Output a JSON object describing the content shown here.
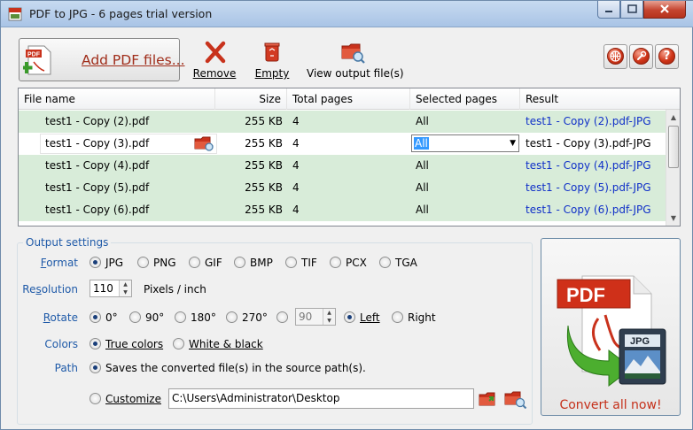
{
  "window": {
    "title": "PDF to JPG - 6 pages trial version"
  },
  "toolbar": {
    "add_pdf_label": "Add PDF files...",
    "remove_label": "Remove",
    "empty_label": "Empty",
    "view_output_label": "View output file(s)"
  },
  "table": {
    "headers": {
      "file_name": "File name",
      "size": "Size",
      "total_pages": "Total pages",
      "selected_pages": "Selected pages",
      "result": "Result"
    },
    "rows": [
      {
        "name": "test1 - Copy (2).pdf",
        "size": "255 KB",
        "pages": "4",
        "selected": "All",
        "result": "test1 - Copy (2).pdf-JPG"
      },
      {
        "name": "test1 - Copy (3).pdf",
        "size": "255 KB",
        "pages": "4",
        "selected": "All",
        "result": "test1 - Copy (3).pdf-JPG"
      },
      {
        "name": "test1 - Copy (4).pdf",
        "size": "255 KB",
        "pages": "4",
        "selected": "All",
        "result": "test1 - Copy (4).pdf-JPG"
      },
      {
        "name": "test1 - Copy (5).pdf",
        "size": "255 KB",
        "pages": "4",
        "selected": "All",
        "result": "test1 - Copy (5).pdf-JPG"
      },
      {
        "name": "test1 - Copy (6).pdf",
        "size": "255 KB",
        "pages": "4",
        "selected": "All",
        "result": "test1 - Copy (6).pdf-JPG"
      }
    ]
  },
  "settings": {
    "legend": "Output settings",
    "format_label": "Format",
    "formats": [
      "JPG",
      "PNG",
      "GIF",
      "BMP",
      "TIF",
      "PCX",
      "TGA"
    ],
    "format_selected": "JPG",
    "resolution_label": "Resolution",
    "resolution_value": "110",
    "resolution_unit": "Pixels / inch",
    "rotate_label": "Rotate",
    "rotations": [
      "0°",
      "90°",
      "180°",
      "270°"
    ],
    "rotate_selected": "0°",
    "custom_angle": "90",
    "direction_left": "Left",
    "direction_right": "Right",
    "direction_selected": "Left",
    "colors_label": "Colors",
    "color_true": "True colors",
    "color_bw": "White & black",
    "colors_selected": "True colors",
    "path_label": "Path",
    "path_source": "Saves the converted file(s) in the source path(s).",
    "path_customize": "Customize",
    "path_value": "C:\\Users\\Administrator\\Desktop",
    "path_selected": "source"
  },
  "convert": {
    "label": "Convert all now!",
    "pdf_badge": "PDF",
    "jpg_badge": "JPG"
  },
  "colors": {
    "accent_blue": "#1f5aa8",
    "row_green": "#d8ecd9",
    "link_blue": "#1030c8",
    "brand_red": "#c5301a"
  }
}
